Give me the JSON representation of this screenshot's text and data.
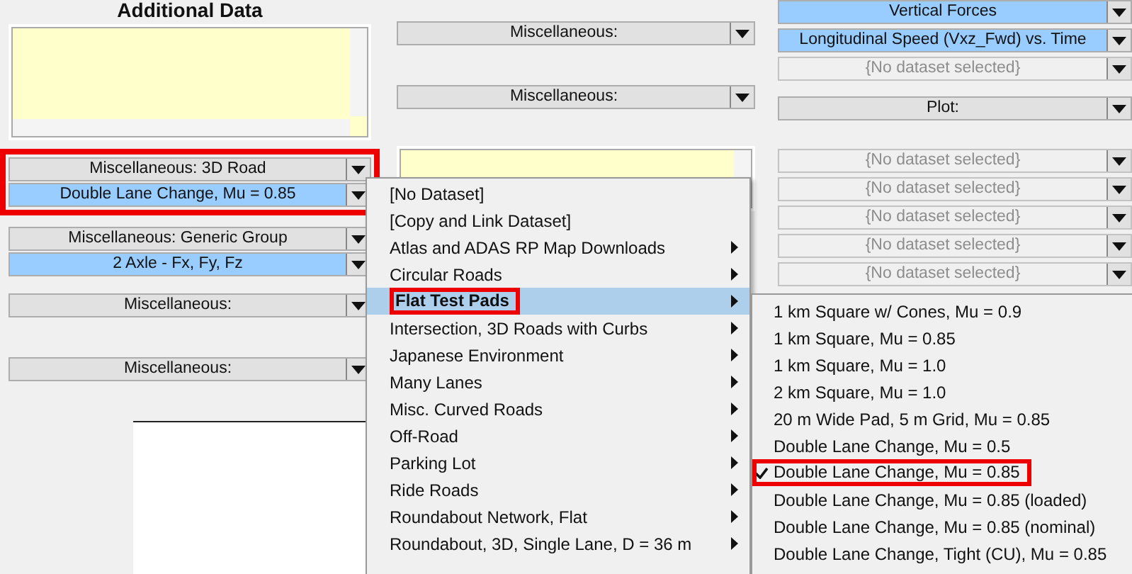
{
  "left_panel": {
    "title": "Additional Data",
    "groups": [
      [
        {
          "text": "Miscellaneous: 3D Road",
          "kind": "gray"
        },
        {
          "text": "Double Lane Change, Mu = 0.85",
          "kind": "blue"
        }
      ],
      [
        {
          "text": "Miscellaneous: Generic Group",
          "kind": "gray"
        },
        {
          "text": "2 Axle - Fx, Fy, Fz",
          "kind": "blue"
        }
      ],
      [
        {
          "text": "Miscellaneous:",
          "kind": "gray"
        }
      ],
      [
        {
          "text": "Miscellaneous:",
          "kind": "gray"
        }
      ]
    ]
  },
  "middle_panel": {
    "dropdowns": [
      {
        "text": "Miscellaneous:",
        "kind": "gray"
      },
      {
        "text": "Miscellaneous:",
        "kind": "gray"
      }
    ]
  },
  "right_panel": {
    "groups": [
      [
        {
          "text": "Vertical Forces",
          "kind": "blue"
        },
        {
          "text": "Longitudinal Speed (Vxz_Fwd) vs. Time",
          "kind": "blue"
        },
        {
          "text": "{No dataset selected}",
          "kind": "empty"
        },
        {
          "text": "Plot:",
          "kind": "gray"
        }
      ],
      [
        {
          "text": "{No dataset selected}",
          "kind": "empty"
        },
        {
          "text": "{No dataset selected}",
          "kind": "empty"
        },
        {
          "text": "{No dataset selected}",
          "kind": "empty"
        },
        {
          "text": "{No dataset selected}",
          "kind": "empty"
        },
        {
          "text": "{No dataset selected}",
          "kind": "empty"
        }
      ]
    ]
  },
  "menu": {
    "items": [
      {
        "label": "[No Dataset]",
        "submenu": false,
        "selected": false
      },
      {
        "label": "[Copy and Link Dataset]",
        "submenu": false,
        "selected": false
      },
      {
        "label": "Atlas and ADAS RP Map Downloads",
        "submenu": true,
        "selected": false
      },
      {
        "label": "Circular Roads",
        "submenu": true,
        "selected": false
      },
      {
        "label": "Flat Test Pads",
        "submenu": true,
        "selected": true
      },
      {
        "label": "Intersection, 3D Roads with Curbs",
        "submenu": true,
        "selected": false
      },
      {
        "label": "Japanese Environment",
        "submenu": true,
        "selected": false
      },
      {
        "label": "Many Lanes",
        "submenu": true,
        "selected": false
      },
      {
        "label": "Misc. Curved Roads",
        "submenu": true,
        "selected": false
      },
      {
        "label": "Off-Road",
        "submenu": true,
        "selected": false
      },
      {
        "label": "Parking Lot",
        "submenu": true,
        "selected": false
      },
      {
        "label": "Ride Roads",
        "submenu": true,
        "selected": false
      },
      {
        "label": "Roundabout Network, Flat",
        "submenu": true,
        "selected": false
      },
      {
        "label": "Roundabout, 3D, Single Lane, D = 36 m",
        "submenu": true,
        "selected": false
      }
    ]
  },
  "submenu": {
    "items": [
      {
        "label": "1 km Square w/ Cones, Mu = 0.9",
        "checked": false
      },
      {
        "label": "1 km Square, Mu = 0.85",
        "checked": false
      },
      {
        "label": "1 km Square, Mu = 1.0",
        "checked": false
      },
      {
        "label": "2 km Square, Mu = 1.0",
        "checked": false
      },
      {
        "label": "20 m Wide Pad, 5 m Grid, Mu = 0.85",
        "checked": false
      },
      {
        "label": "Double Lane Change, Mu = 0.5",
        "checked": false
      },
      {
        "label": "Double Lane Change, Mu = 0.85",
        "checked": true
      },
      {
        "label": "Double Lane Change, Mu = 0.85 (loaded)",
        "checked": false
      },
      {
        "label": "Double Lane Change, Mu = 0.85 (nominal)",
        "checked": false
      },
      {
        "label": "Double Lane Change, Tight (CU), Mu = 0.85",
        "checked": false
      }
    ]
  }
}
